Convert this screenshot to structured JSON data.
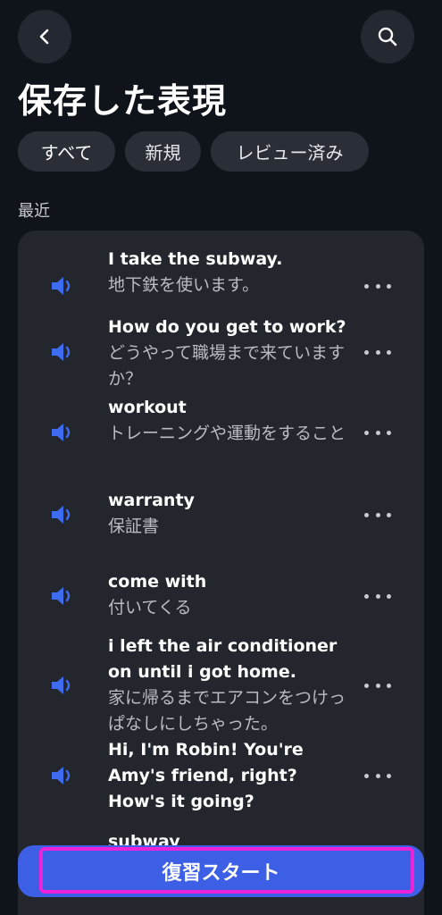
{
  "header": {
    "title": "保存した表現",
    "back_icon": "chevron-left-icon",
    "search_icon": "search-icon"
  },
  "filters": {
    "all": "すべて",
    "new": "新規",
    "reviewed": "レビュー済み"
  },
  "section_label": "最近",
  "items": [
    {
      "en": "I take the subway.",
      "ja": "地下鉄を使います。"
    },
    {
      "en": "How do you get to work?",
      "ja": "どうやって職場まで来ていますか？"
    },
    {
      "en": "workout",
      "ja": "トレーニングや運動をすること"
    },
    {
      "en": "warranty",
      "ja": "保証書"
    },
    {
      "en": "come with",
      "ja": "付いてくる"
    },
    {
      "en": "i left the air conditioner on until i got home.",
      "ja": "家に帰るまでエアコンをつけっぱなしにしちゃった。"
    },
    {
      "en": "Hi, I'm Robin! You're Amy's friend, right? How's it going?",
      "ja": ""
    },
    {
      "en": "subway",
      "ja": ""
    }
  ],
  "start_button": "復習スタート",
  "colors": {
    "background": "#0f131a",
    "card": "#23262d",
    "accent": "#3d5fe6",
    "speaker": "#3d6cf0",
    "annotation": "#ee22d8"
  }
}
